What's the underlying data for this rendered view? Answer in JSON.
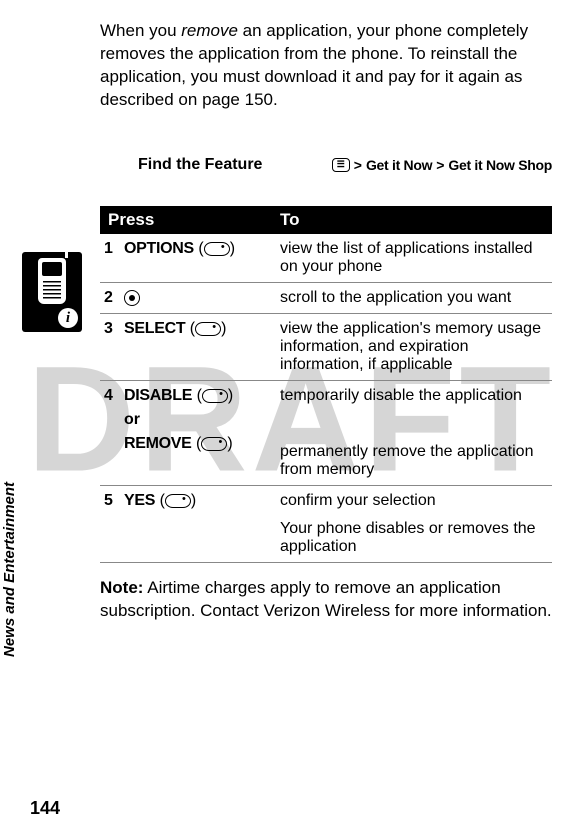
{
  "watermark": "DRAFT",
  "sideTab": "News and Entertainment",
  "pageNumber": "144",
  "intro": {
    "pre": "When you ",
    "em": "remove",
    "post": " an application, your phone completely removes the application from the phone. To reinstall the application, you must download it and pay for it again as described on page 150."
  },
  "findFeature": {
    "label": "Find the Feature",
    "pathPrefix": ">",
    "item1": "Get it Now",
    "sep": ">",
    "item2": "Get it Now Shop"
  },
  "table": {
    "headers": {
      "press": "Press",
      "to": "To"
    },
    "rows": [
      {
        "num": "1",
        "action": "OPTIONS",
        "iconType": "softkey",
        "desc": "view the list of applications installed on your phone"
      },
      {
        "num": "2",
        "action": "",
        "iconType": "nav",
        "desc": "scroll to the application you want"
      },
      {
        "num": "3",
        "action": "SELECT",
        "iconType": "softkey",
        "desc": "view the application's memory usage information, and expiration information, if applicable"
      },
      {
        "num": "4",
        "action": "DISABLE",
        "iconType": "softkey",
        "or": "or",
        "action2": "REMOVE",
        "iconType2": "softkey",
        "desc": "temporarily disable the application",
        "desc2": "permanently remove the application from memory"
      },
      {
        "num": "5",
        "action": "YES",
        "iconType": "softkey",
        "desc": "confirm your selection",
        "desc2": "Your phone disables or removes the application"
      }
    ]
  },
  "note": {
    "label": "Note:",
    "text": " Airtime charges apply to remove an application subscription. Contact Verizon Wireless for more information."
  }
}
